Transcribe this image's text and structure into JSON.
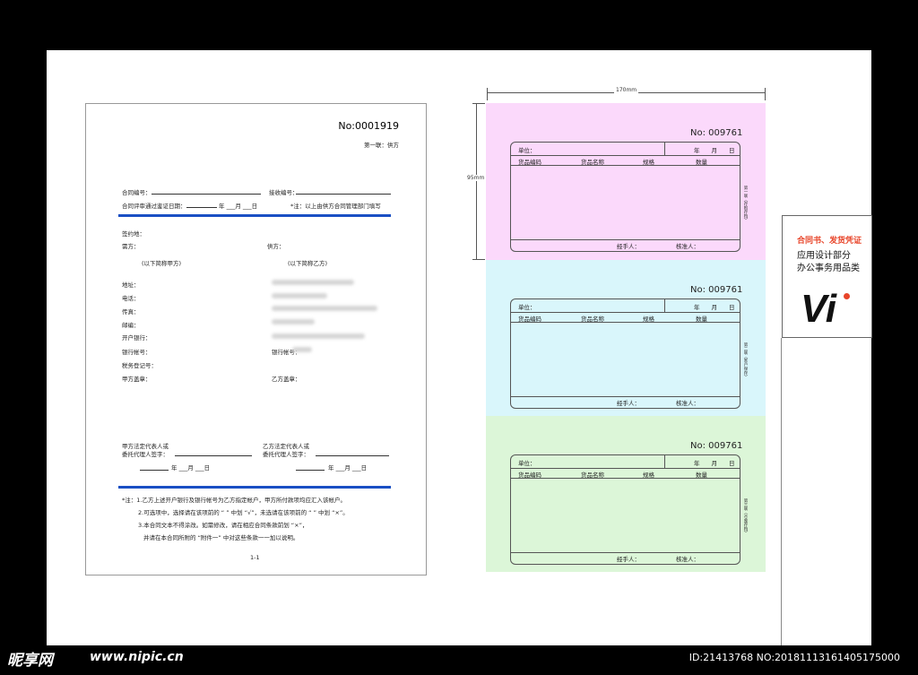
{
  "contract": {
    "number": "No:0001919",
    "copy_label": "第一联：供方",
    "contract_no_label": "合同编号：",
    "receive_no_label": "接收编号：",
    "review_date_label": "合同评审通过鉴证日期：",
    "date_suffix": "年 ___月 ___日",
    "note_fill": "*注：以上由供方合同管理部门填写",
    "place_label": "签约地：",
    "buyer_label": "需方：",
    "seller_label": "供方：",
    "buyer_alias": "(以下简称甲方)",
    "seller_alias": "(以下简称乙方)",
    "address_label": "地址：",
    "phone_label": "电话：",
    "fax_label": "传真：",
    "zip_label": "邮编：",
    "bank_label": "开户银行：",
    "account_label": "银行帐号：",
    "account_label_seller": "银行帐号：",
    "tax_label": "税务登记号：",
    "seal_a": "甲方盖章：",
    "seal_b": "乙方盖章：",
    "rep_a_1": "甲方法定代表人或",
    "rep_a_2": "委托代理人签字：",
    "rep_b_1": "乙方法定代表人或",
    "rep_b_2": "委托代理人签字：",
    "sign_date_a": "年 ___月 ___日",
    "sign_date_b": "年 ___月 ___日",
    "notes": [
      "*注：1.乙方上述开户银行及银行帐号为乙方指定帐户，甲方所付款项均应汇入该帐户。",
      "2.可选项中，选择请在该项前的 “ ” 中划 “√”，未选请在该项前的 “ ” 中划 “×”。",
      "3.本合同文本不得涂改。如需修改，请在相应合同条款前划 “×”，",
      "并请在本合同所附的 “附件一” 中对这些条款一一加以说明。"
    ],
    "page_no": "1-1"
  },
  "dimensions": {
    "width_label": "170mm",
    "height_label": "95mm"
  },
  "receipts": [
    {
      "no": "No: 009761",
      "color": "#fbd9fb",
      "side_label": "第一联（存根存档）"
    },
    {
      "no": "No: 009761",
      "color": "#d9f6fb",
      "side_label": "第二联（客户保存）"
    },
    {
      "no": "No: 009761",
      "color": "#dcf6d8",
      "side_label": "第三联（仓库存档）"
    }
  ],
  "receipt_fields": {
    "unit": "单位：",
    "date": "年　　月　　日",
    "code": "货品编码",
    "name": "货品名称",
    "spec": "规格",
    "qty": "数量",
    "handler": "经手人：",
    "approver": "核准人："
  },
  "panel": {
    "line1": "合同书、发货凭证",
    "line2": "应用设计部分",
    "line3": "办公事务用品类",
    "logo_text": "Vi",
    "accent": "#e8452a"
  },
  "watermark": {
    "brand": "昵享网",
    "site": "www.nipic.cn",
    "id": "ID:21413768 NO:20181113161405175000"
  }
}
